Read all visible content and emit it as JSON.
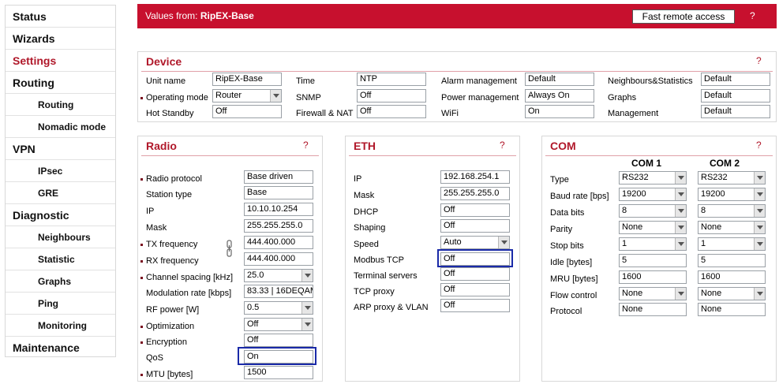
{
  "sidebar": {
    "items": [
      {
        "label": "Status"
      },
      {
        "label": "Wizards"
      },
      {
        "label": "Settings"
      },
      {
        "label": "Routing"
      },
      {
        "label": "Routing"
      },
      {
        "label": "Nomadic mode"
      },
      {
        "label": "VPN"
      },
      {
        "label": "IPsec"
      },
      {
        "label": "GRE"
      },
      {
        "label": "Diagnostic"
      },
      {
        "label": "Neighbours"
      },
      {
        "label": "Statistic"
      },
      {
        "label": "Graphs"
      },
      {
        "label": "Ping"
      },
      {
        "label": "Monitoring"
      },
      {
        "label": "Maintenance"
      }
    ]
  },
  "header": {
    "values_prefix": "Values from: ",
    "unit": "RipEX-Base",
    "remote_label": "Fast remote access",
    "help": "?"
  },
  "device": {
    "title": "Device",
    "help": "?",
    "labels": {
      "unit_name": "Unit name",
      "operating_mode": "Operating mode",
      "hot_standby": "Hot Standby",
      "time": "Time",
      "snmp": "SNMP",
      "firewall": "Firewall & NAT",
      "alarm": "Alarm management",
      "power": "Power management",
      "wifi": "WiFi",
      "neighbours": "Neighbours&Statistics",
      "graphs": "Graphs",
      "management": "Management"
    },
    "values": {
      "unit_name": "RipEX-Base",
      "operating_mode": "Router",
      "hot_standby": "Off",
      "time": "NTP",
      "snmp": "Off",
      "firewall": "Off",
      "alarm": "Default",
      "power": "Always On",
      "wifi": "On",
      "neighbours": "Default",
      "graphs": "Default",
      "management": "Default"
    }
  },
  "radio": {
    "title": "Radio",
    "help": "?",
    "labels": {
      "protocol": "Radio protocol",
      "station_type": "Station type",
      "ip": "IP",
      "mask": "Mask",
      "tx": "TX frequency",
      "rx": "RX frequency",
      "spacing": "Channel spacing [kHz]",
      "modulation": "Modulation rate [kbps]",
      "rf_power": "RF power [W]",
      "optimization": "Optimization",
      "encryption": "Encryption",
      "qos": "QoS",
      "mtu": "MTU [bytes]"
    },
    "values": {
      "protocol": "Base driven",
      "station_type": "Base",
      "ip": "10.10.10.254",
      "mask": "255.255.255.0",
      "tx": "444.400.000",
      "rx": "444.400.000",
      "spacing": "25.0",
      "modulation": "83.33 | 16DEQAM",
      "rf_power": "0.5",
      "optimization": "Off",
      "encryption": "Off",
      "qos": "On",
      "mtu": "1500"
    }
  },
  "eth": {
    "title": "ETH",
    "help": "?",
    "labels": {
      "ip": "IP",
      "mask": "Mask",
      "dhcp": "DHCP",
      "shaping": "Shaping",
      "speed": "Speed",
      "modbus": "Modbus TCP",
      "terminal": "Terminal servers",
      "tcp_proxy": "TCP proxy",
      "arp_proxy": "ARP proxy & VLAN"
    },
    "values": {
      "ip": "192.168.254.1",
      "mask": "255.255.255.0",
      "dhcp": "Off",
      "shaping": "Off",
      "speed": "Auto",
      "modbus": "Off",
      "terminal": "Off",
      "tcp_proxy": "Off",
      "arp_proxy": "Off"
    }
  },
  "com": {
    "title": "COM",
    "help": "?",
    "col1": "COM 1",
    "col2": "COM 2",
    "labels": {
      "type": "Type",
      "baud": "Baud rate [bps]",
      "data_bits": "Data bits",
      "parity": "Parity",
      "stop_bits": "Stop bits",
      "idle": "Idle [bytes]",
      "mru": "MRU [bytes]",
      "flow": "Flow control",
      "protocol": "Protocol"
    },
    "com1": {
      "type": "RS232",
      "baud": "19200",
      "data_bits": "8",
      "parity": "None",
      "stop_bits": "1",
      "idle": "5",
      "mru": "1600",
      "flow": "None",
      "protocol": "None"
    },
    "com2": {
      "type": "RS232",
      "baud": "19200",
      "data_bits": "8",
      "parity": "None",
      "stop_bits": "1",
      "idle": "5",
      "mru": "1600",
      "flow": "None",
      "protocol": "None"
    }
  }
}
